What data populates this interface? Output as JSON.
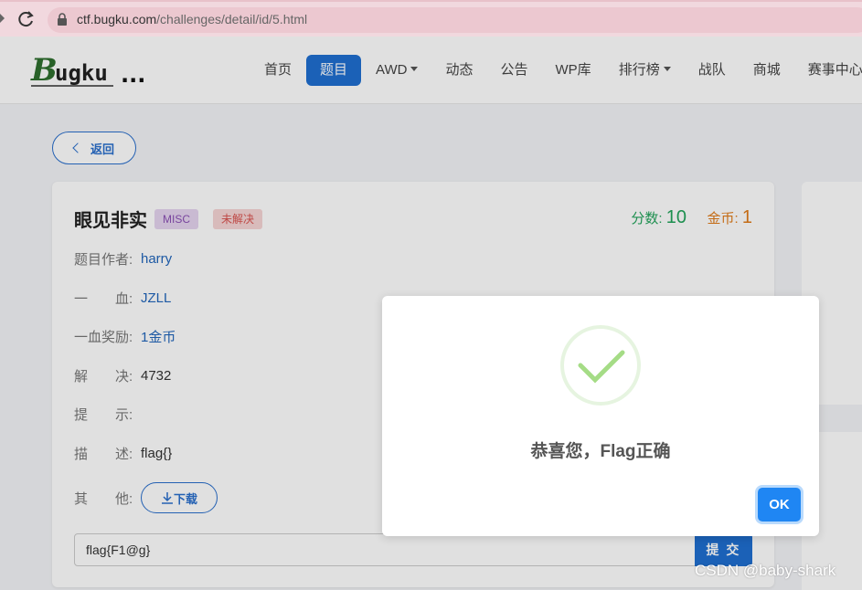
{
  "browser": {
    "url_host": "ctf.bugku.com",
    "url_path": "/challenges/detail/id/5.html"
  },
  "navbar": {
    "logo_text": "Bugku...",
    "items": [
      {
        "label": "首页"
      },
      {
        "label": "题目",
        "active": true
      },
      {
        "label": "AWD",
        "dropdown": true
      },
      {
        "label": "动态"
      },
      {
        "label": "公告"
      },
      {
        "label": "WP库"
      },
      {
        "label": "排行榜",
        "dropdown": true
      },
      {
        "label": "战队"
      },
      {
        "label": "商城"
      },
      {
        "label": "赛事中心"
      }
    ]
  },
  "page": {
    "back_label": "返回"
  },
  "challenge": {
    "title": "眼见非实",
    "category_tag": "MISC",
    "status_tag": "未解决",
    "score_label": "分数:",
    "score_value": "10",
    "coins_label": "金币:",
    "coins_value": "1",
    "fields": {
      "author_label": "题目作者:",
      "author_value": "harry",
      "blood_label": "一　　血:",
      "blood_value": "JZLL",
      "reward_label": "一血奖励:",
      "reward_value": "1金币",
      "solved_label": "解　　决:",
      "solved_value": "4732",
      "hint_label": "提　　示:",
      "desc_label": "描　　述:",
      "desc_value": "flag{}",
      "other_label": "其　　他:",
      "download_label": "下载"
    },
    "flag_input_value": "flag{F1@g}",
    "submit_label": "提 交"
  },
  "modal": {
    "message": "恭喜您，Flag正确",
    "ok_label": "OK",
    "icon": "success-check-icon"
  },
  "watermark": "CSDN @baby-shark",
  "colors": {
    "primary": "#1f6fd1",
    "success": "#22a35a",
    "coins": "#e07b1a",
    "misc_tag_bg": "#e5d4ef",
    "unsolved_tag_bg": "#f6d5d5",
    "ok_button": "#1f86f3"
  }
}
